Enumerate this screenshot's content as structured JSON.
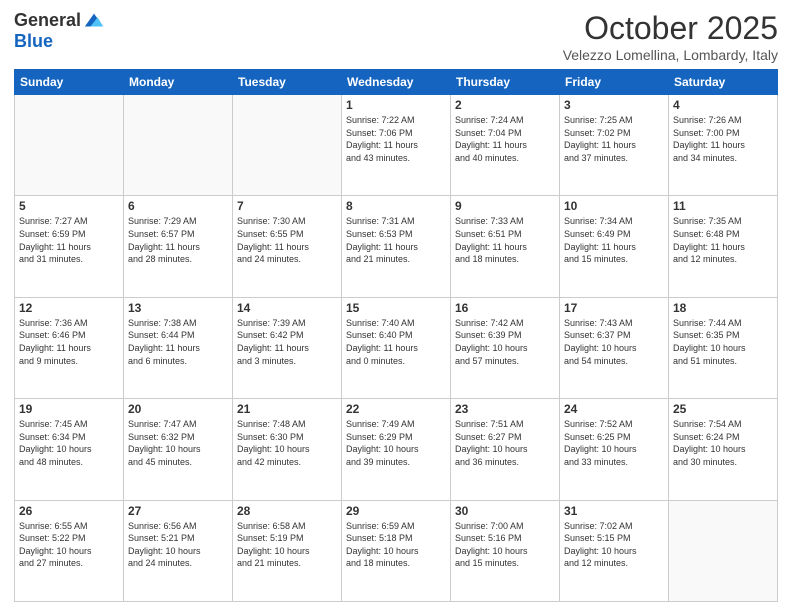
{
  "logo": {
    "general": "General",
    "blue": "Blue"
  },
  "header": {
    "month": "October 2025",
    "location": "Velezzo Lomellina, Lombardy, Italy"
  },
  "weekdays": [
    "Sunday",
    "Monday",
    "Tuesday",
    "Wednesday",
    "Thursday",
    "Friday",
    "Saturday"
  ],
  "weeks": [
    [
      {
        "day": "",
        "info": ""
      },
      {
        "day": "",
        "info": ""
      },
      {
        "day": "",
        "info": ""
      },
      {
        "day": "1",
        "info": "Sunrise: 7:22 AM\nSunset: 7:06 PM\nDaylight: 11 hours\nand 43 minutes."
      },
      {
        "day": "2",
        "info": "Sunrise: 7:24 AM\nSunset: 7:04 PM\nDaylight: 11 hours\nand 40 minutes."
      },
      {
        "day": "3",
        "info": "Sunrise: 7:25 AM\nSunset: 7:02 PM\nDaylight: 11 hours\nand 37 minutes."
      },
      {
        "day": "4",
        "info": "Sunrise: 7:26 AM\nSunset: 7:00 PM\nDaylight: 11 hours\nand 34 minutes."
      }
    ],
    [
      {
        "day": "5",
        "info": "Sunrise: 7:27 AM\nSunset: 6:59 PM\nDaylight: 11 hours\nand 31 minutes."
      },
      {
        "day": "6",
        "info": "Sunrise: 7:29 AM\nSunset: 6:57 PM\nDaylight: 11 hours\nand 28 minutes."
      },
      {
        "day": "7",
        "info": "Sunrise: 7:30 AM\nSunset: 6:55 PM\nDaylight: 11 hours\nand 24 minutes."
      },
      {
        "day": "8",
        "info": "Sunrise: 7:31 AM\nSunset: 6:53 PM\nDaylight: 11 hours\nand 21 minutes."
      },
      {
        "day": "9",
        "info": "Sunrise: 7:33 AM\nSunset: 6:51 PM\nDaylight: 11 hours\nand 18 minutes."
      },
      {
        "day": "10",
        "info": "Sunrise: 7:34 AM\nSunset: 6:49 PM\nDaylight: 11 hours\nand 15 minutes."
      },
      {
        "day": "11",
        "info": "Sunrise: 7:35 AM\nSunset: 6:48 PM\nDaylight: 11 hours\nand 12 minutes."
      }
    ],
    [
      {
        "day": "12",
        "info": "Sunrise: 7:36 AM\nSunset: 6:46 PM\nDaylight: 11 hours\nand 9 minutes."
      },
      {
        "day": "13",
        "info": "Sunrise: 7:38 AM\nSunset: 6:44 PM\nDaylight: 11 hours\nand 6 minutes."
      },
      {
        "day": "14",
        "info": "Sunrise: 7:39 AM\nSunset: 6:42 PM\nDaylight: 11 hours\nand 3 minutes."
      },
      {
        "day": "15",
        "info": "Sunrise: 7:40 AM\nSunset: 6:40 PM\nDaylight: 11 hours\nand 0 minutes."
      },
      {
        "day": "16",
        "info": "Sunrise: 7:42 AM\nSunset: 6:39 PM\nDaylight: 10 hours\nand 57 minutes."
      },
      {
        "day": "17",
        "info": "Sunrise: 7:43 AM\nSunset: 6:37 PM\nDaylight: 10 hours\nand 54 minutes."
      },
      {
        "day": "18",
        "info": "Sunrise: 7:44 AM\nSunset: 6:35 PM\nDaylight: 10 hours\nand 51 minutes."
      }
    ],
    [
      {
        "day": "19",
        "info": "Sunrise: 7:45 AM\nSunset: 6:34 PM\nDaylight: 10 hours\nand 48 minutes."
      },
      {
        "day": "20",
        "info": "Sunrise: 7:47 AM\nSunset: 6:32 PM\nDaylight: 10 hours\nand 45 minutes."
      },
      {
        "day": "21",
        "info": "Sunrise: 7:48 AM\nSunset: 6:30 PM\nDaylight: 10 hours\nand 42 minutes."
      },
      {
        "day": "22",
        "info": "Sunrise: 7:49 AM\nSunset: 6:29 PM\nDaylight: 10 hours\nand 39 minutes."
      },
      {
        "day": "23",
        "info": "Sunrise: 7:51 AM\nSunset: 6:27 PM\nDaylight: 10 hours\nand 36 minutes."
      },
      {
        "day": "24",
        "info": "Sunrise: 7:52 AM\nSunset: 6:25 PM\nDaylight: 10 hours\nand 33 minutes."
      },
      {
        "day": "25",
        "info": "Sunrise: 7:54 AM\nSunset: 6:24 PM\nDaylight: 10 hours\nand 30 minutes."
      }
    ],
    [
      {
        "day": "26",
        "info": "Sunrise: 6:55 AM\nSunset: 5:22 PM\nDaylight: 10 hours\nand 27 minutes."
      },
      {
        "day": "27",
        "info": "Sunrise: 6:56 AM\nSunset: 5:21 PM\nDaylight: 10 hours\nand 24 minutes."
      },
      {
        "day": "28",
        "info": "Sunrise: 6:58 AM\nSunset: 5:19 PM\nDaylight: 10 hours\nand 21 minutes."
      },
      {
        "day": "29",
        "info": "Sunrise: 6:59 AM\nSunset: 5:18 PM\nDaylight: 10 hours\nand 18 minutes."
      },
      {
        "day": "30",
        "info": "Sunrise: 7:00 AM\nSunset: 5:16 PM\nDaylight: 10 hours\nand 15 minutes."
      },
      {
        "day": "31",
        "info": "Sunrise: 7:02 AM\nSunset: 5:15 PM\nDaylight: 10 hours\nand 12 minutes."
      },
      {
        "day": "",
        "info": ""
      }
    ]
  ]
}
